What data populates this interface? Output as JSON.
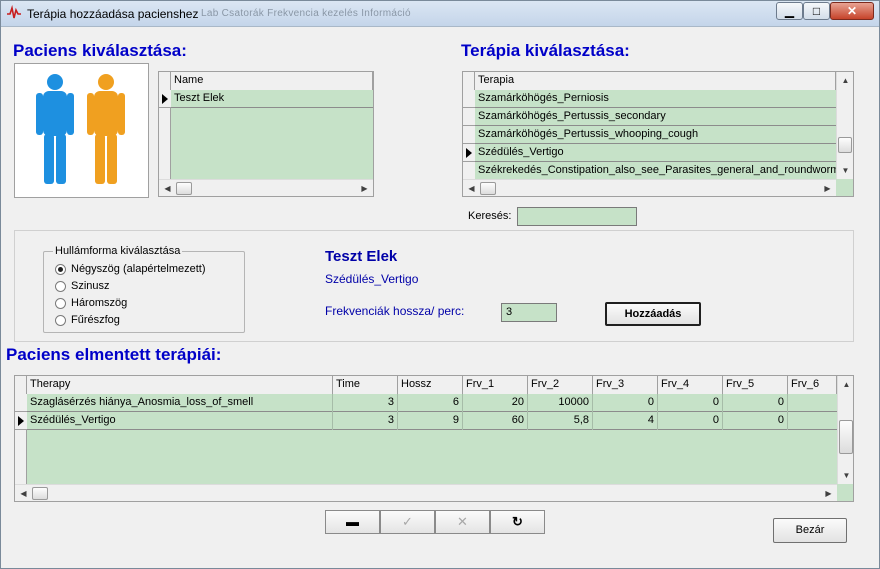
{
  "window": {
    "title": "Terápia hozzáadása pacienshez",
    "background_tabs": "Lab   Csatorák   Frekvencia kezelés   Információ",
    "buttons": {
      "minimize": "▁",
      "maximize": "□",
      "close": "✕"
    }
  },
  "patient_section": {
    "heading": "Paciens kiválasztása:",
    "grid": {
      "column": "Name",
      "rows": [
        {
          "name": "Teszt Elek",
          "selected": true
        }
      ]
    }
  },
  "therapy_section": {
    "heading": "Terápia kiválasztása:",
    "grid": {
      "column": "Terapia",
      "rows": [
        {
          "name": "Szamárköhögés_Perniosis",
          "selected": false
        },
        {
          "name": "Szamárköhögés_Pertussis_secondary",
          "selected": false
        },
        {
          "name": "Szamárköhögés_Pertussis_whooping_cough",
          "selected": false
        },
        {
          "name": "Szédülés_Vertigo",
          "selected": true
        },
        {
          "name": "Székrekedés_Constipation_also_see_Parasites_general_and_roundworm_s",
          "selected": false
        }
      ]
    },
    "search_label": "Keresés:",
    "search_value": ""
  },
  "waveform": {
    "legend": "Hullámforma kiválasztása",
    "options": [
      {
        "label": "Négyszög (alapértelmezett)",
        "selected": true
      },
      {
        "label": "Szinusz",
        "selected": false
      },
      {
        "label": "Háromszög",
        "selected": false
      },
      {
        "label": "Fűrészfog",
        "selected": false
      }
    ]
  },
  "summary": {
    "patient_name": "Teszt Elek",
    "therapy_name": "Szédülés_Vertigo",
    "freq_label": "Frekvenciák hossza/ perc:",
    "freq_value": "3",
    "add_button": "Hozzáadás"
  },
  "saved_section": {
    "heading": "Paciens elmentett terápiái:",
    "columns": [
      "Therapy",
      "Time",
      "Hossz",
      "Frv_1",
      "Frv_2",
      "Frv_3",
      "Frv_4",
      "Frv_5",
      "Frv_6"
    ],
    "rows": [
      {
        "selected": false,
        "cells": [
          "Szaglásérzés hiánya_Anosmia_loss_of_smell",
          "3",
          "6",
          "20",
          "10000",
          "0",
          "0",
          "0",
          ""
        ]
      },
      {
        "selected": true,
        "cells": [
          "Szédülés_Vertigo",
          "3",
          "9",
          "60",
          "5,8",
          "4",
          "0",
          "0",
          ""
        ]
      }
    ]
  },
  "navigator": {
    "delete": "▬",
    "post": "✓",
    "cancel": "✕",
    "refresh": "↻"
  },
  "close_button": "Bezár",
  "colors": {
    "heading": "#0000c8",
    "grid_bg": "#c6e2c8",
    "accent_text": "#0000a8"
  }
}
